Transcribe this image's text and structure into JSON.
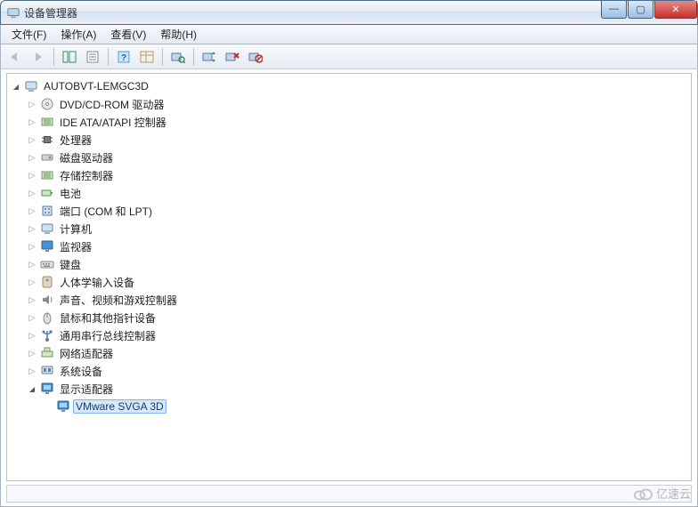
{
  "window": {
    "title": "设备管理器",
    "controls": {
      "min": "—",
      "max": "▢",
      "close": "✕"
    }
  },
  "menu": {
    "file": "文件(F)",
    "action": "操作(A)",
    "view": "查看(V)",
    "help": "帮助(H)"
  },
  "toolbar": {
    "back": "后退",
    "forward": "前进",
    "show_hide_tree": "显示/隐藏控制台树",
    "properties": "属性",
    "help": "帮助",
    "detail": "详细信息",
    "scan": "扫描检测硬件改动",
    "update": "更新驱动程序",
    "uninstall": "卸载",
    "disable": "禁用"
  },
  "tree": {
    "root": {
      "label": "AUTOBVT-LEMGC3D",
      "expanded": true
    },
    "categories": [
      {
        "id": "dvd",
        "label": "DVD/CD-ROM 驱动器",
        "icon": "disc"
      },
      {
        "id": "ide",
        "label": "IDE ATA/ATAPI 控制器",
        "icon": "controller"
      },
      {
        "id": "cpu",
        "label": "处理器",
        "icon": "chip"
      },
      {
        "id": "disk",
        "label": "磁盘驱动器",
        "icon": "drive"
      },
      {
        "id": "storage",
        "label": "存储控制器",
        "icon": "controller"
      },
      {
        "id": "battery",
        "label": "电池",
        "icon": "battery"
      },
      {
        "id": "ports",
        "label": "端口 (COM 和 LPT)",
        "icon": "port"
      },
      {
        "id": "computer",
        "label": "计算机",
        "icon": "computer"
      },
      {
        "id": "monitor",
        "label": "监视器",
        "icon": "monitor"
      },
      {
        "id": "keyboard",
        "label": "键盘",
        "icon": "keyboard"
      },
      {
        "id": "hid",
        "label": "人体学输入设备",
        "icon": "hid"
      },
      {
        "id": "sound",
        "label": "声音、视频和游戏控制器",
        "icon": "sound"
      },
      {
        "id": "mouse",
        "label": "鼠标和其他指针设备",
        "icon": "mouse"
      },
      {
        "id": "usb",
        "label": "通用串行总线控制器",
        "icon": "usb"
      },
      {
        "id": "network",
        "label": "网络适配器",
        "icon": "network"
      },
      {
        "id": "system",
        "label": "系统设备",
        "icon": "system"
      },
      {
        "id": "display",
        "label": "显示适配器",
        "icon": "display",
        "expanded": true,
        "children": [
          {
            "id": "vmware-svga",
            "label": "VMware SVGA 3D",
            "icon": "display",
            "selected": true
          }
        ]
      }
    ]
  },
  "watermark": "亿速云"
}
